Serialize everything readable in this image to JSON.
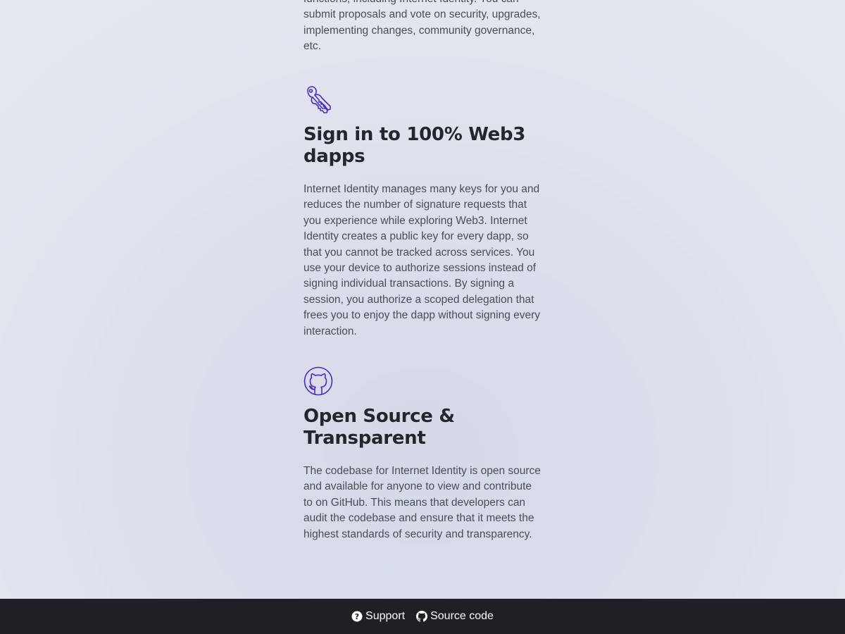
{
  "intro": {
    "text": "functions, including Internet Identity. You can submit proposals and vote on security, upgrades, implementing changes, community governance, etc."
  },
  "features": [
    {
      "icon": "keys-icon",
      "title": "Sign in to 100% Web3 dapps",
      "body": "Internet Identity manages many keys for you and reduces the number of signature requests that you experience while exploring Web3. Internet Identity creates a public key for every dapp, so that you cannot be tracked across services. You use your device to authorize sessions instead of signing individual transactions. By signing a session, you authorize a scoped delegation that frees you to enjoy the dapp without signing every interaction."
    },
    {
      "icon": "github-icon",
      "title": "Open Source & Transparent",
      "body": "The codebase for Internet Identity is open source and available for anyone to view and contribute to on GitHub. This means that developers can audit the codebase and ensure that it meets the highest standards of security and transparency."
    }
  ],
  "footer": {
    "support_label": "Support",
    "support_icon": "question-circle-icon",
    "source_label": "Source code",
    "source_icon": "github-icon"
  },
  "colors": {
    "accent": "#4a2bc9",
    "footer_bg": "#1f2026"
  }
}
